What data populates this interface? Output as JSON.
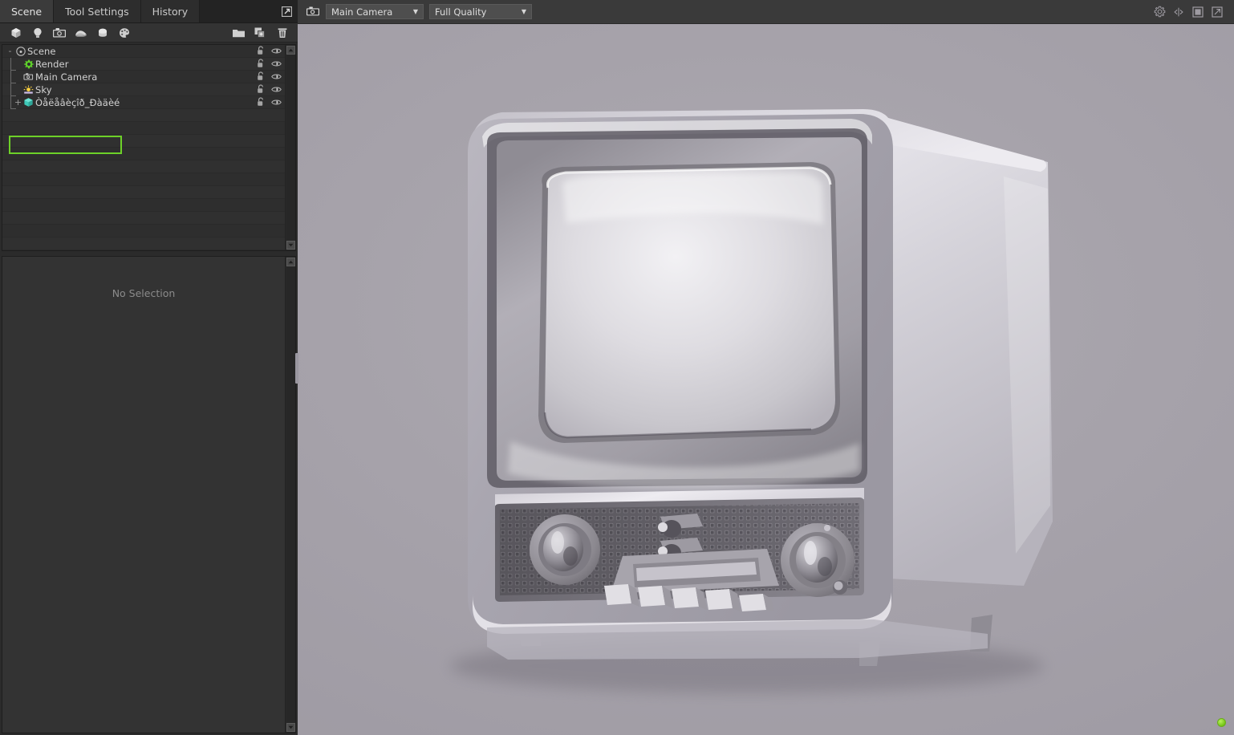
{
  "panel": {
    "tabs": [
      {
        "label": "Scene",
        "active": true
      },
      {
        "label": "Tool Settings",
        "active": false
      },
      {
        "label": "History",
        "active": false
      }
    ],
    "popout_icon": "popout-icon",
    "toolbar": {
      "items": [
        {
          "name": "add-mesh-icon",
          "label": "Add Mesh"
        },
        {
          "name": "add-light-icon",
          "label": "Add Light"
        },
        {
          "name": "add-camera-icon",
          "label": "Add Camera"
        },
        {
          "name": "add-sky-icon",
          "label": "Add Sky"
        },
        {
          "name": "add-primitive-icon",
          "label": "Add Primitive"
        },
        {
          "name": "add-material-icon",
          "label": "Add Material"
        }
      ],
      "right_items": [
        {
          "name": "new-folder-icon",
          "label": "New Folder"
        },
        {
          "name": "duplicate-icon",
          "label": "Duplicate"
        },
        {
          "name": "delete-icon",
          "label": "Delete"
        }
      ]
    },
    "tree": {
      "rows": [
        {
          "label": "Scene",
          "depth": 0,
          "expander": "-",
          "icon": "scene-icon",
          "locked": false,
          "visible": true
        },
        {
          "label": "Render",
          "depth": 1,
          "expander": "",
          "icon": "render-icon",
          "locked": false,
          "visible": true
        },
        {
          "label": "Main Camera",
          "depth": 1,
          "expander": "",
          "icon": "camera-icon",
          "locked": false,
          "visible": true
        },
        {
          "label": "Sky",
          "depth": 1,
          "expander": "",
          "icon": "sky-icon",
          "locked": false,
          "visible": true
        },
        {
          "label": "Òåëåâèçîð_Ðàäèé",
          "depth": 1,
          "expander": "+",
          "icon": "mesh-icon",
          "locked": false,
          "visible": true,
          "selected": true
        }
      ],
      "lock_icon": "unlocked-padlock-icon",
      "eye_icon": "visibility-eye-icon",
      "selection_outline_color": "#6dd128"
    },
    "properties": {
      "empty_message": "No Selection"
    }
  },
  "viewport": {
    "camera_icon": "camera-icon",
    "camera_select": {
      "value": "Main Camera",
      "caret": "▼"
    },
    "quality_select": {
      "value": "Full Quality",
      "caret": "▼"
    },
    "header_icons": [
      {
        "name": "settings-gear-icon"
      },
      {
        "name": "split-view-icon"
      },
      {
        "name": "maximize-icon"
      },
      {
        "name": "expand-fullscreen-icon"
      }
    ],
    "scene_object": "Vintage CRT television 3D render",
    "status_indicator": {
      "name": "render-status-dot",
      "color": "#7cc81a"
    },
    "background_color": "#a6a2aa"
  }
}
